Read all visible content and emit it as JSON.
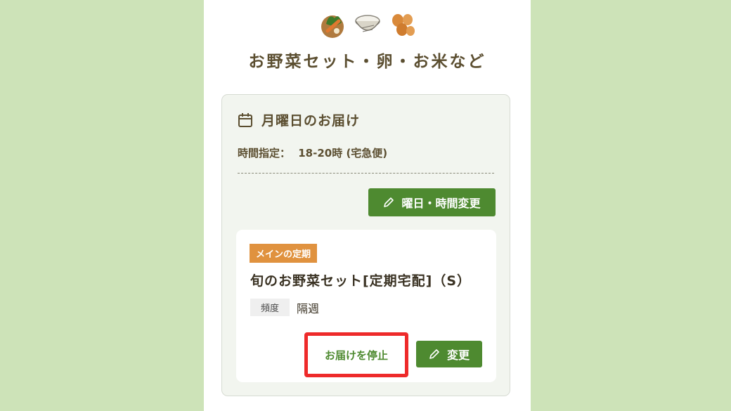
{
  "header": {
    "icons": [
      "vegetables-icon",
      "rice-icon",
      "eggs-icon"
    ],
    "title": "お野菜セット・卵・お米など"
  },
  "delivery": {
    "day_title": "月曜日のお届け",
    "time_label": "時間指定：",
    "time_value": "18-20時 (宅急便)",
    "change_day_label": "曜日・時間変更"
  },
  "subscription": {
    "badge": "メインの定期",
    "product_name": "旬のお野菜セット[定期宅配]（S）",
    "frequency_label": "頻度",
    "frequency_value": "隔週",
    "stop_label": "お届けを停止",
    "change_label": "変更"
  },
  "colors": {
    "background": "#cde3b8",
    "accent_green": "#4e8a30",
    "badge_orange": "#e0923f",
    "highlight_red": "#ee2a2a"
  }
}
